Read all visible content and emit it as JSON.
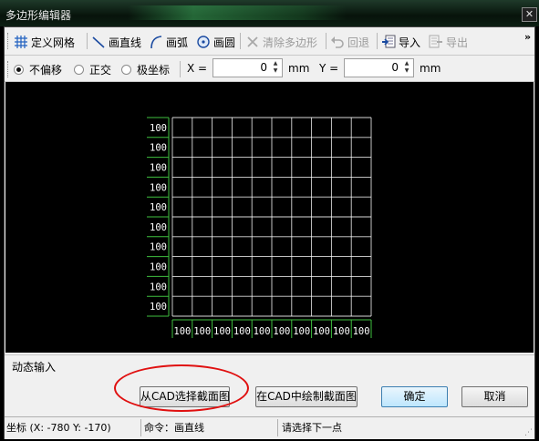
{
  "window": {
    "title": "多边形编辑器",
    "close_glyph": "✕"
  },
  "toolbar": {
    "items": [
      {
        "label": "定义网格",
        "icon": "grid-icon"
      },
      {
        "label": "画直线",
        "icon": "line-icon"
      },
      {
        "label": "画弧",
        "icon": "arc-icon"
      },
      {
        "label": "画圆",
        "icon": "circle-icon"
      },
      {
        "label": "清除多边形",
        "icon": "delete-icon",
        "disabled": true
      },
      {
        "label": "回退",
        "icon": "undo-icon",
        "disabled": true
      },
      {
        "label": "导入",
        "icon": "import-icon"
      },
      {
        "label": "导出",
        "icon": "export-icon",
        "disabled": true
      }
    ],
    "more_glyph": "»"
  },
  "options": {
    "modes": [
      {
        "label": "不偏移",
        "selected": true
      },
      {
        "label": "正交",
        "selected": false
      },
      {
        "label": "极坐标",
        "selected": false
      }
    ],
    "x_label": "X =",
    "x_value": "0",
    "y_label": "Y =",
    "y_value": "0",
    "unit": "mm"
  },
  "grid": {
    "rows": 10,
    "cols": 10,
    "row_labels": [
      "100",
      "100",
      "100",
      "100",
      "100",
      "100",
      "100",
      "100",
      "100",
      "100"
    ],
    "col_labels": [
      "100",
      "100",
      "100",
      "100",
      "100",
      "100",
      "100",
      "100",
      "100",
      "100"
    ],
    "line_color": "#ffffff",
    "dim_color": "#3fbf3f"
  },
  "tabs": {
    "dynamic_input": "动态输入"
  },
  "buttons": {
    "select_from_cad": "从CAD选择截面图",
    "draw_in_cad": "在CAD中绘制截面图",
    "ok": "确定",
    "cancel": "取消"
  },
  "status": {
    "coords": "坐标 (X: -780 Y: -170)",
    "command": "命令：画直线",
    "prompt": "请选择下一点"
  },
  "colors": {
    "highlight_ellipse": "#e01010"
  }
}
